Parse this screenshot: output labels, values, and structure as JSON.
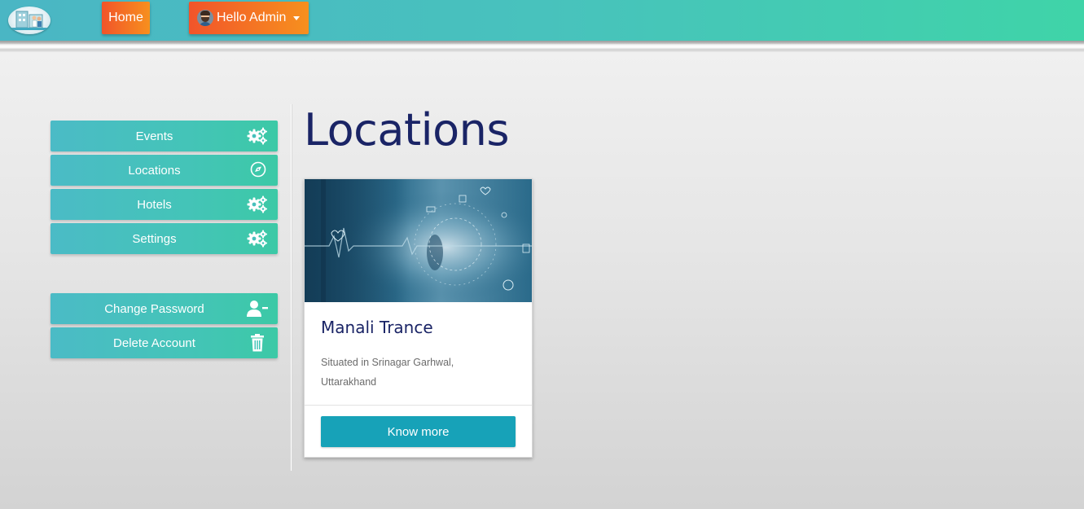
{
  "navbar": {
    "home_label": "Home",
    "user_menu_label": "Hello Admin",
    "logo_icon": "hospital-logo-icon",
    "avatar_icon": "user-avatar-icon"
  },
  "sidebar": {
    "items": [
      {
        "label": "Events",
        "icon": "gears-icon"
      },
      {
        "label": "Locations",
        "icon": "compass-icon"
      },
      {
        "label": "Hotels",
        "icon": "gears-icon"
      },
      {
        "label": "Settings",
        "icon": "gears-icon"
      }
    ],
    "account_items": [
      {
        "label": "Change Password",
        "icon": "user-minus-icon"
      },
      {
        "label": "Delete Account",
        "icon": "trash-icon"
      }
    ]
  },
  "main": {
    "title": "Locations",
    "cards": [
      {
        "title": "Manali Trance",
        "description": "Situated in Srinagar Garhwal, Uttarakhand",
        "button_label": "Know more",
        "image_icon": "medical-tech-image"
      }
    ]
  },
  "colors": {
    "topbar_start": "#4ab6c4",
    "topbar_end": "#3fd4a8",
    "nav_button_start": "#f1542a",
    "nav_button_end": "#f7901e",
    "sidebar_button": "#44c4b8",
    "title_text": "#1a2466",
    "card_button": "#17a2b8"
  }
}
